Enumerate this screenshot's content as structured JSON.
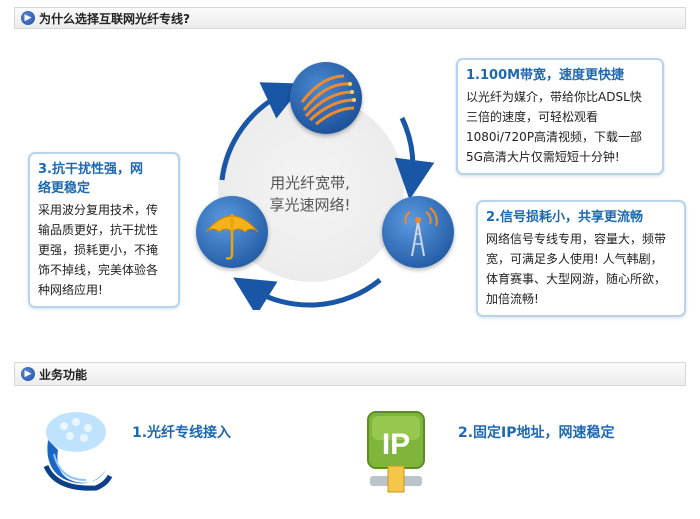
{
  "section1": {
    "title": "为什么选择互联网光纤专线?"
  },
  "center": {
    "line1": "用光纤宽带,",
    "line2": "享光速网络!"
  },
  "bubbles": [
    {
      "title": "1.100M带宽，速度更快捷",
      "lines": [
        "以光纤为媒介，带给你比ADSL快",
        "三倍的速度，可轻松观看",
        "1080i/720P高清视频，下载一部",
        "5G高清大片仅需短短十分钟!"
      ]
    },
    {
      "title": "2.信号损耗小，共享更流畅",
      "lines": [
        "网络信号专线专用，容量大，频带",
        "宽，可满足多人使用! 人气韩剧，",
        "体育赛事、大型网游，随心所欲，",
        "加倍流畅!"
      ]
    },
    {
      "title_lines": [
        "3.抗干扰性强，网",
        "络更稳定"
      ],
      "lines": [
        "采用波分复用技术，传",
        "输品质更好，抗干扰性",
        "更强，损耗更小，不掩",
        "饰不掉线，完美体验各",
        "种网络应用!"
      ]
    }
  ],
  "section2": {
    "title": "业务功能"
  },
  "features": [
    {
      "label": "1.光纤专线接入",
      "icon": "fiber-bundle-icon"
    },
    {
      "label": "2.固定IP地址，网速稳定",
      "icon": "ip-icon",
      "icon_text": "IP"
    }
  ],
  "colors": {
    "accent": "#1e68b0",
    "bubble_border": "#b9d3ea",
    "arrow": "#1a56a6",
    "ip_green": "#7fb53a"
  }
}
